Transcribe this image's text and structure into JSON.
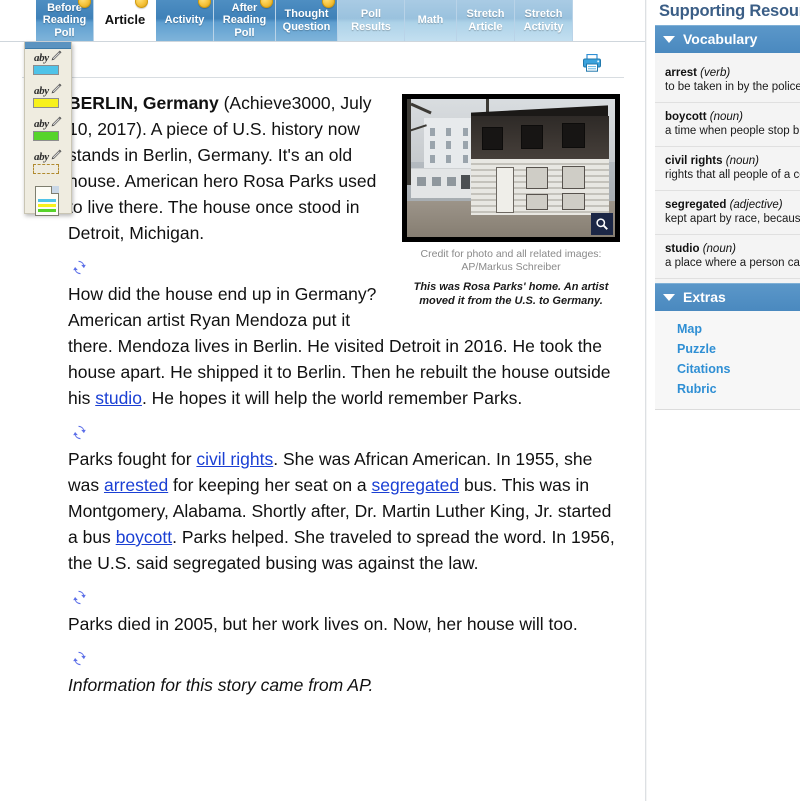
{
  "tabs": [
    {
      "label": "Before Reading Poll",
      "state": "done",
      "badge": true
    },
    {
      "label": "Article",
      "state": "active",
      "badge": true
    },
    {
      "label": "Activity",
      "state": "done",
      "badge": true
    },
    {
      "label": "After Reading Poll",
      "state": "done",
      "badge": true
    },
    {
      "label": "Thought Question",
      "state": "done",
      "badge": true
    },
    {
      "label": "Poll Results",
      "state": "dim",
      "badge": false
    },
    {
      "label": "Math",
      "state": "dim",
      "badge": false
    },
    {
      "label": "Stretch Article",
      "state": "dim",
      "badge": false
    },
    {
      "label": "Stretch Activity",
      "state": "dim",
      "badge": false
    }
  ],
  "toolbar": {
    "tools": [
      {
        "name": "highlighter-blue",
        "label": "aby",
        "color": "#4fc3e8"
      },
      {
        "name": "highlighter-yellow",
        "label": "aby",
        "color": "#f7f11c"
      },
      {
        "name": "highlighter-green",
        "label": "aby",
        "color": "#57d42a"
      },
      {
        "name": "highlighter-none",
        "label": "aby",
        "color": ""
      },
      {
        "name": "my-notes",
        "label": "",
        "color": ""
      }
    ]
  },
  "article": {
    "print_label": "Print",
    "lede_dateline": "BERLIN, Germany",
    "lede_rest": " (Achieve3000, July 10, 2017). A piece of U.S. history now stands in Berlin, Germany. It's an old house. American hero Rosa Parks used to live there. The house once stood in Detroit, Michigan.",
    "p2_a": "How did the house end up in Germany? American artist Ryan Mendoza put it there. Mendoza lives in Berlin. He visited Detroit in 2016. He took the house apart. He shipped it to Berlin. Then he rebuilt the house outside his ",
    "p2_link": "studio",
    "p2_b": ". He hopes it will help the world remember Parks.",
    "p3_a": "Parks fought for ",
    "p3_link1": "civil rights",
    "p3_b": ". She was African American. In 1955, she was ",
    "p3_link2": "arrested",
    "p3_c": " for keeping her seat on a ",
    "p3_link3": "segregated",
    "p3_d": " bus. This was in Montgomery, Alabama. Shortly after, Dr. Martin Luther King, Jr. started a bus ",
    "p3_link4": "boycott",
    "p3_e": ". Parks helped. She traveled to spread the word. In 1956, the U.S. said segregated busing was against the law.",
    "p4": "Parks died in 2005, but her work lives on. Now, her house will too.",
    "source_note": "Information for this story came from AP.",
    "figure": {
      "credit": "Credit for photo and all related images: AP/Markus Schreiber",
      "caption": "This was Rosa Parks' home. An artist moved it from the U.S. to Germany.",
      "zoom_label": "Enlarge photo"
    }
  },
  "sidebar": {
    "title": "Supporting Resources",
    "sections": [
      {
        "name": "vocabulary",
        "heading": "Vocabulary",
        "items": [
          {
            "word": "arrest",
            "pos": "(verb)",
            "def": "to be taken in by the police for possibly doing something wrong"
          },
          {
            "word": "boycott",
            "pos": "(noun)",
            "def": "a time when people stop buying or using something, often in hopes of getting a rule or law changed"
          },
          {
            "word": "civil rights",
            "pos": "(noun)",
            "def": "rights that all people of a country should have"
          },
          {
            "word": "segregated",
            "pos": "(adjective)",
            "def": "kept apart by race, because of a law"
          },
          {
            "word": "studio",
            "pos": "(noun)",
            "def": "a place where a person can write, draw, paint, or make other art"
          }
        ]
      },
      {
        "name": "extras",
        "heading": "Extras",
        "links": [
          {
            "label": "Map"
          },
          {
            "label": "Puzzle"
          },
          {
            "label": "Citations"
          },
          {
            "label": "Rubric"
          }
        ]
      }
    ]
  },
  "colors": {
    "tab_active_blue": "#3f81b8",
    "tab_dim_blue": "#9ac2de",
    "sidebar_header_blue": "#4a89bf",
    "link_blue": "#1a3fd4",
    "extras_link_blue": "#2f8fd4",
    "sidebar_title_blue": "#3b5e86"
  }
}
